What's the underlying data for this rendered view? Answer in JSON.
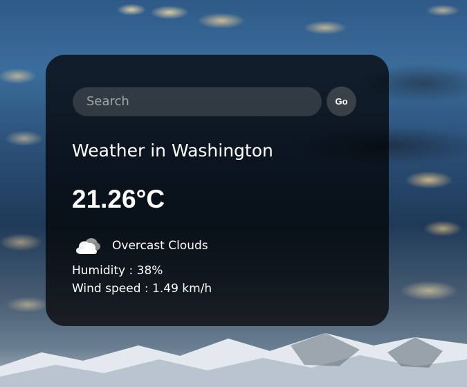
{
  "search": {
    "placeholder": "Search",
    "value": "",
    "go_label": "Go"
  },
  "weather": {
    "city_prefix": "Weather in",
    "city": "Washington",
    "temperature": "21.26",
    "unit": "°C",
    "description": "Overcast Clouds",
    "icon": "cloud-icon",
    "humidity_label": "Humidity :",
    "humidity_value": "38%",
    "wind_label": "Wind speed :",
    "wind_value": "1.49 km/h"
  },
  "colors": {
    "card_background": "#000000",
    "text": "#ffffff"
  }
}
